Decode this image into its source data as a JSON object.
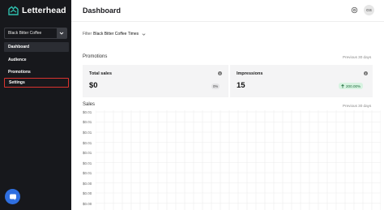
{
  "app": {
    "name": "Letterhead",
    "brand_color": "#2fbfae"
  },
  "sidebar": {
    "publication_selected": "Black Bitter Coffee",
    "items": [
      {
        "label": "Dashboard",
        "active": true
      },
      {
        "label": "Audience",
        "active": false
      },
      {
        "label": "Promotions",
        "active": false
      },
      {
        "label": "Settings",
        "active": false,
        "highlighted": true
      }
    ],
    "help_icon": "chat-bubble-icon"
  },
  "header": {
    "title": "Dashboard",
    "settings_icon": "gear-icon",
    "avatar_initials": "GS"
  },
  "filter": {
    "label": "Filter",
    "value": "Black Bitter Coffee Times"
  },
  "promotions": {
    "title": "Promotions",
    "period": "Previous 30 days",
    "cards": [
      {
        "title": "Total sales",
        "value": "$0",
        "badge": "0%"
      },
      {
        "title": "Impressions",
        "value": "15",
        "badge": "200.00%",
        "badge_color": "#d7f3e1"
      }
    ]
  },
  "sales": {
    "title": "Sales",
    "period": "Previous 30 days",
    "y_ticks": [
      "$0.01",
      "$0.01",
      "$0.01",
      "$0.01",
      "$0.01",
      "$0.01",
      "$0.01",
      "$0.00",
      "$0.00",
      "$0.00"
    ]
  }
}
